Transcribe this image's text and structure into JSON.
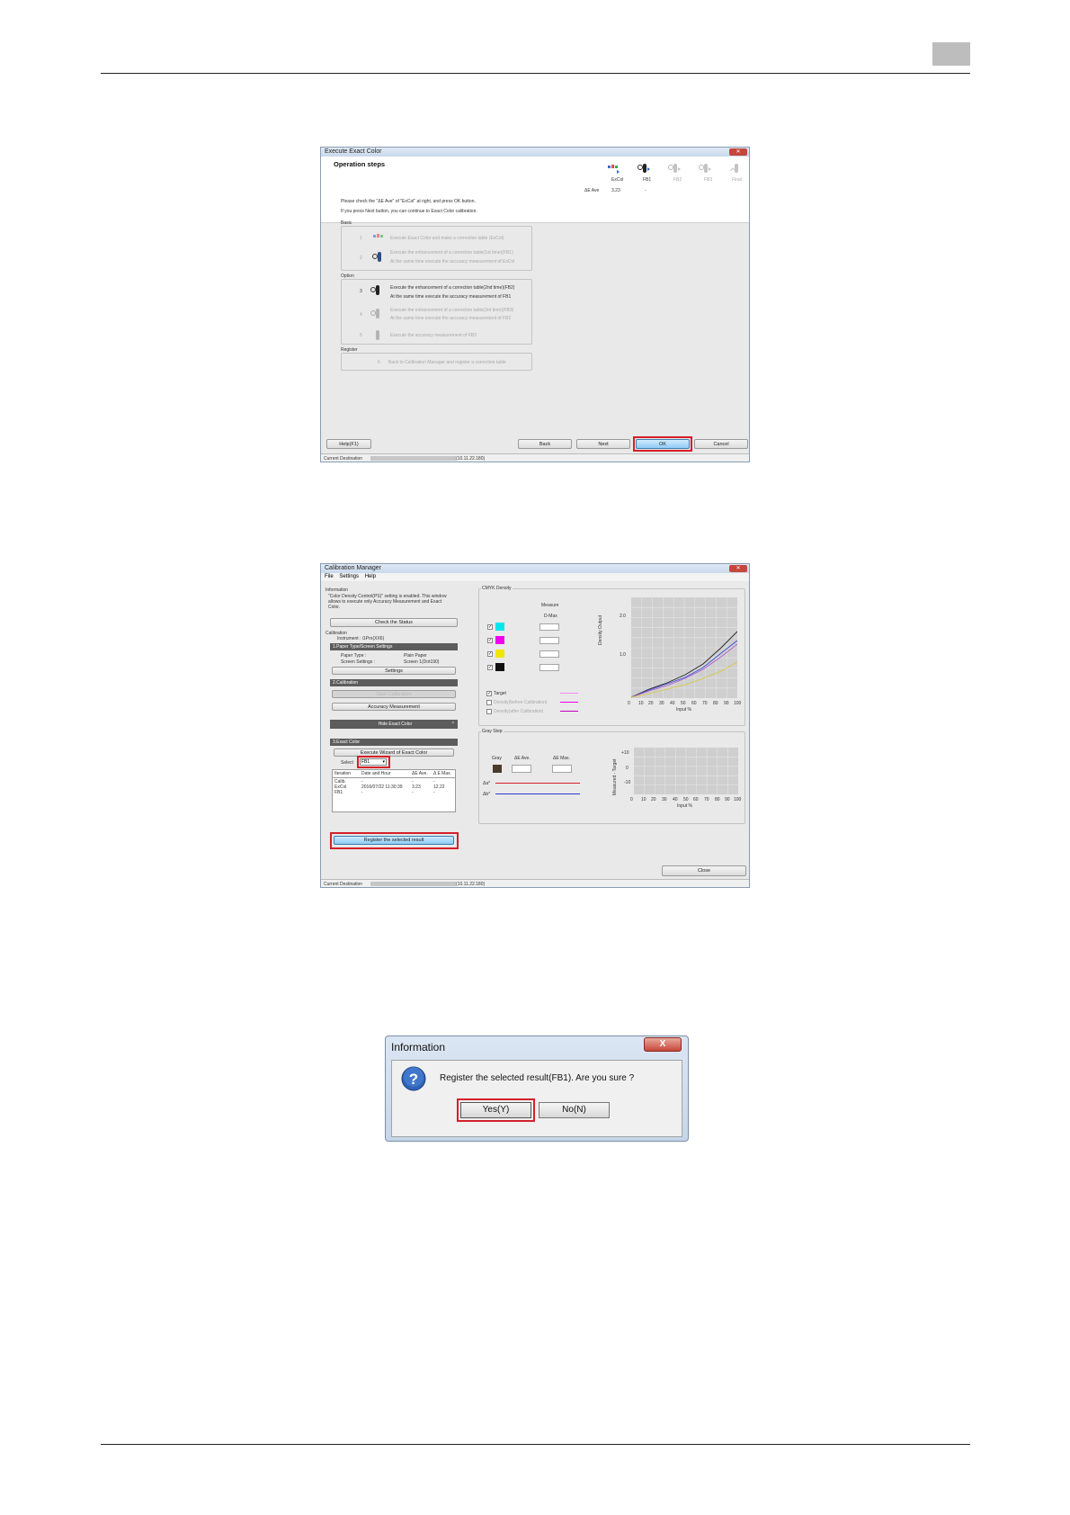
{
  "window1": {
    "title": "Execute Exact Color",
    "heading": "Operation steps",
    "instruction1": "Please check the \"ΔE Ave\" of \"ExCol\" at right, and press OK button.",
    "instruction2": "If you press Next button, you can continue to Exact Color calibration.",
    "steps": [
      "ExCol",
      "FB1",
      "FB2",
      "FB3",
      "Final"
    ],
    "de_ave_label": "ΔE Ave",
    "de_ave_values": [
      "3.23",
      "-"
    ],
    "basic_label": "Basic",
    "basic_items": [
      {
        "num": "1",
        "text": "Execute Exact Color and make a correction table (ExCol)"
      },
      {
        "num": "2",
        "text": "Execute the enhancement of a correction table(1st time)(FB1)",
        "text2": "At the same time execute the accuracy measurement of ExCol"
      }
    ],
    "option_label": "Option",
    "option_items": [
      {
        "num": "3",
        "text": "Execute the enhancement of a correction table(2nd time)(FB2)",
        "text2": "At the same time execute the accuracy measurement of FB1"
      },
      {
        "num": "4",
        "text": "Execute the enhancement of a correction table(3rd time)(FB3)",
        "text2": "At the same time execute the accuracy measurement of FB2"
      },
      {
        "num": "5",
        "text": "Execute the accuracy measurement of FB3"
      }
    ],
    "register_label": "Register",
    "register_item": {
      "num": "6",
      "text": "Back to Calibration Manager and register a correction table"
    },
    "buttons": {
      "help": "Help(F1)",
      "back": "Back",
      "next": "Next",
      "ok": "OK",
      "cancel": "Cancel"
    },
    "status_label": "Current Destination",
    "status_value": "(10.11.22.180)"
  },
  "window2": {
    "title": "Calibration Manager",
    "menu": [
      "File",
      "Settings",
      "Help"
    ],
    "info_label": "Information",
    "info_text1": "\"Color Density Control(PS)\" setting is enabled. This window",
    "info_text2": "allows to execute only Accuracy Measurement and Exact",
    "info_text3": "Color.",
    "check_status": "Check the Status",
    "calibration_label": "Calibration",
    "instrument": "Instrument : i1Pro(XX6)",
    "paper_section": "1.Paper Type/Screen Settings",
    "paper_type_label": "Paper Type :",
    "paper_type_value": "Plain Paper",
    "screen_label": "Screen Settings :",
    "screen_value": "Screen 1(Dot190)",
    "settings_btn": "Settings",
    "cal_section": "2.Calibration",
    "start_cal": "Start Calibration",
    "accuracy": "Accuracy Measurement",
    "hide_exact": "Hide Exact Color",
    "exact_section": "3.Exact Color",
    "execute_wizard": "Execute Wizard of Exact Color",
    "select_label": "Select",
    "select_value": "FB1",
    "table_headers": [
      "Iteration",
      "Date and Hour",
      "ΔE Ave.",
      "Δ E Max."
    ],
    "table_rows": [
      [
        "Calib.",
        "-",
        "-",
        "-"
      ],
      [
        "ExCol",
        "2016/07/22 11:30:39",
        "3.23",
        "12.22"
      ],
      [
        "FB1",
        "-",
        "-",
        "-"
      ]
    ],
    "register_btn": "Register the selected result",
    "cmyk_label": "CMYK Density",
    "measure_label": "Measure",
    "dmax_label": "D-Max",
    "legend": [
      "Target",
      "Density(before Calibration)",
      "Density(after Calibration)"
    ],
    "y_axis": "Density Output",
    "y_ticks": [
      "2.0",
      "1.0"
    ],
    "x_ticks": [
      "0",
      "10",
      "20",
      "30",
      "40",
      "50",
      "60",
      "70",
      "80",
      "90",
      "100"
    ],
    "x_axis": "Input %",
    "gray_label": "Gray Step",
    "gray_col": "Gray",
    "de_ave": "ΔE Ave.",
    "de_max": "ΔE Max.",
    "da_label": "Δa*",
    "db_label": "Δb*",
    "gray_y_axis": "Measured - Target",
    "gray_y_ticks": [
      "+10",
      "0",
      "-10"
    ],
    "close_btn": "Close",
    "status_label": "Current Destination",
    "status_value": "(10.11.22.180)"
  },
  "dialog": {
    "title": "Information",
    "message": "Register the selected result(FB1). Are you sure ?",
    "yes": "Yes(Y)",
    "no": "No(N)",
    "close": "X"
  },
  "colors": {
    "highlight": "#d4202a",
    "cyan": "#00e5ee",
    "magenta": "#ee00ee",
    "yellow": "#f0e600",
    "black": "#111111"
  }
}
